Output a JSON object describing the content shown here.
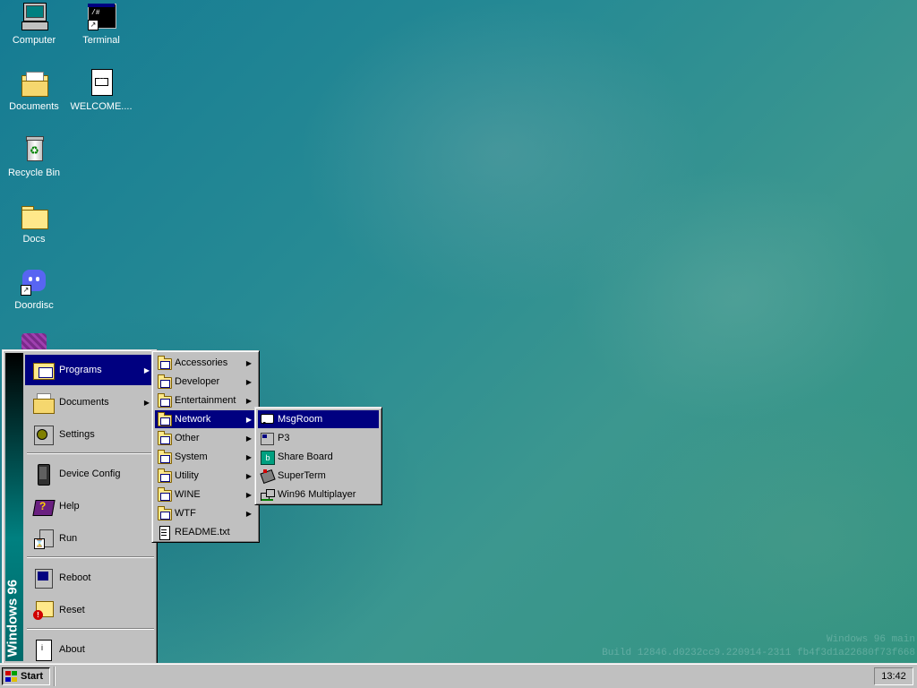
{
  "desktop": {
    "icons": [
      {
        "label": "Computer",
        "icon": "computer-icon"
      },
      {
        "label": "Terminal",
        "icon": "terminal-icon"
      },
      {
        "label": "Documents",
        "icon": "documents-folder-icon"
      },
      {
        "label": "WELCOME....",
        "icon": "markdown-file-icon"
      },
      {
        "label": "Recycle Bin",
        "icon": "recycle-bin-icon"
      },
      {
        "label": "Docs",
        "icon": "folder-icon"
      },
      {
        "label": "Doordisc",
        "icon": "doordisc-icon"
      }
    ],
    "watermark_line1": "Windows 96 main",
    "watermark_line2": "Build 12846.d0232cc9.220914-2311 fb4f3d1a22680f73f668"
  },
  "start_menu": {
    "brand": "Windows 96",
    "items": [
      {
        "label": "Programs",
        "icon": "programs-icon",
        "submenu": true
      },
      {
        "label": "Documents",
        "icon": "documents-icon",
        "submenu": true
      },
      {
        "label": "Settings",
        "icon": "settings-icon",
        "submenu": false
      },
      {
        "label": "Device Config",
        "icon": "device-config-icon",
        "submenu": false
      },
      {
        "label": "Help",
        "icon": "help-icon",
        "submenu": false
      },
      {
        "label": "Run",
        "icon": "run-icon",
        "submenu": false
      },
      {
        "label": "Reboot",
        "icon": "reboot-icon",
        "submenu": false
      },
      {
        "label": "Reset",
        "icon": "reset-icon",
        "submenu": false
      },
      {
        "label": "About",
        "icon": "about-icon",
        "submenu": false
      }
    ]
  },
  "programs_menu": {
    "items": [
      {
        "label": "Accessories",
        "submenu": true
      },
      {
        "label": "Developer",
        "submenu": true
      },
      {
        "label": "Entertainment",
        "submenu": true
      },
      {
        "label": "Network",
        "submenu": true
      },
      {
        "label": "Other",
        "submenu": true
      },
      {
        "label": "System",
        "submenu": true
      },
      {
        "label": "Utility",
        "submenu": true
      },
      {
        "label": "WINE",
        "submenu": true
      },
      {
        "label": "WTF",
        "submenu": true
      },
      {
        "label": "README.txt",
        "submenu": false
      }
    ]
  },
  "network_menu": {
    "items": [
      {
        "label": "MsgRoom",
        "icon": "msgroom-icon"
      },
      {
        "label": "P3",
        "icon": "p3-icon"
      },
      {
        "label": "Share Board",
        "icon": "share-board-icon"
      },
      {
        "label": "SuperTerm",
        "icon": "superterm-icon"
      },
      {
        "label": "Win96 Multiplayer",
        "icon": "multiplayer-icon"
      }
    ]
  },
  "taskbar": {
    "start_label": "Start",
    "clock": "13:42"
  },
  "colors": {
    "highlight": "#000080",
    "face": "#c0c0c0",
    "desktop": "#268a94"
  }
}
